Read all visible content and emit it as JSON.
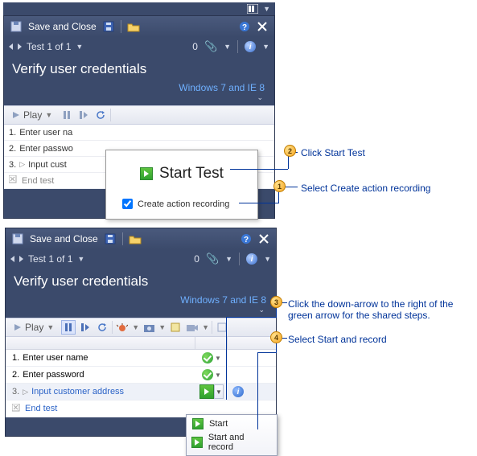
{
  "top_trim_icon": "view-columns",
  "panel1": {
    "toolbar": {
      "save_label": "Save and Close",
      "floppy_icon": "floppy",
      "open_icon": "open-folder",
      "help_icon": "help",
      "close_icon": "close"
    },
    "nav": {
      "test_label": "Test 1 of 1",
      "count": "0",
      "info_icon": "i"
    },
    "title": "Verify user credentials",
    "env_link": "Windows 7 and IE 8",
    "play_label": "Play",
    "steps": [
      {
        "num": "1.",
        "text": "Enter user na"
      },
      {
        "num": "2.",
        "text": "Enter passwo"
      },
      {
        "num": "3.",
        "expander": "▷",
        "text": "Input cust"
      },
      {
        "end_icon": "end",
        "text": "End test"
      }
    ],
    "popup": {
      "start_label": "Start Test",
      "check_label": "Create action recording"
    }
  },
  "panel2": {
    "toolbar": {
      "save_label": "Save and Close",
      "floppy_icon": "floppy",
      "open_icon": "open-folder",
      "help_icon": "help",
      "close_icon": "close"
    },
    "nav": {
      "test_label": "Test 1 of 1",
      "count": "0",
      "info_icon": "i"
    },
    "title": "Verify user credentials",
    "env_link": "Windows 7 and IE 8",
    "play_label": "Play",
    "rows": [
      {
        "num": "1.",
        "text": "Enter user name",
        "status": "pass"
      },
      {
        "num": "2.",
        "text": "Enter password",
        "status": "pass"
      },
      {
        "num": "3.",
        "expander": "▷",
        "text": "Input customer address",
        "shared": true,
        "has_start": true
      },
      {
        "end_icon": "end",
        "text": "End test",
        "shared": true
      }
    ],
    "ctx": {
      "start": "Start",
      "start_record": "Start and record"
    }
  },
  "callouts": {
    "c1": "Select Create action recording",
    "c2": "Click Start Test",
    "c3": "Click the down-arrow to the right of the green arrow for the shared steps.",
    "c4": "Select Start and record"
  }
}
